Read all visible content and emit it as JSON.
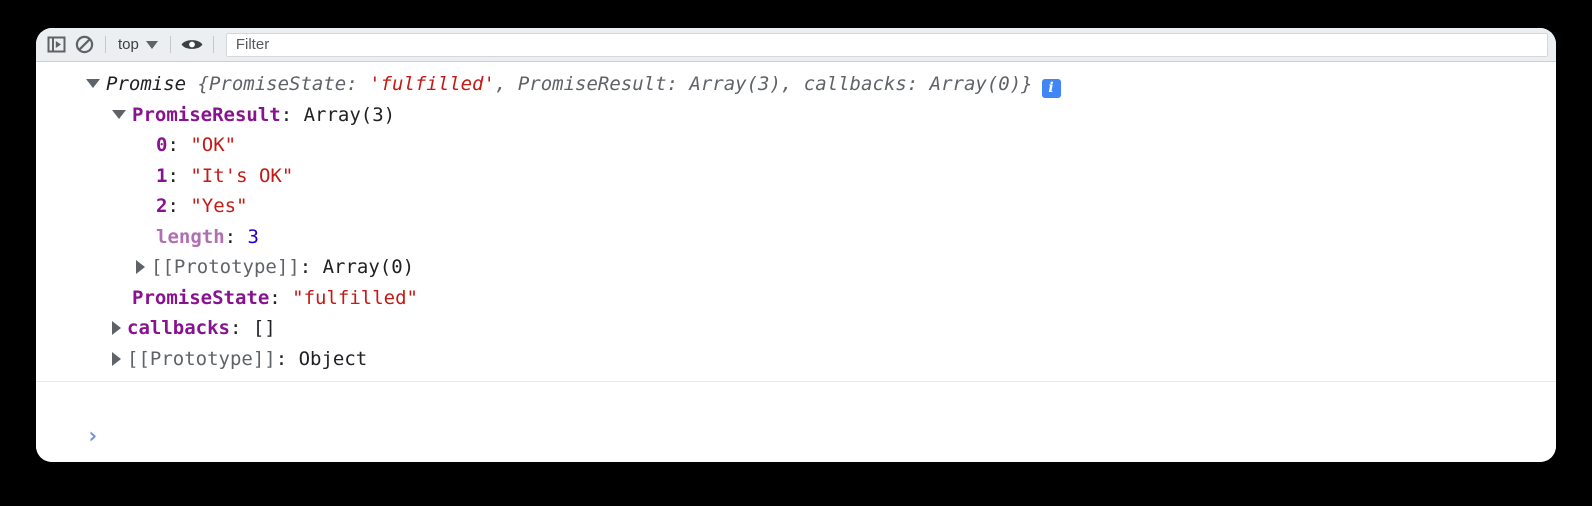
{
  "toolbar": {
    "sidebar_toggle_icon": "sidebar-panel-icon",
    "clear_console_icon": "no-entry-clear-icon",
    "context_label": "top",
    "context_caret_icon": "chevron-down-icon",
    "eye_icon": "eye-live-expression-icon",
    "filter_placeholder": "Filter"
  },
  "console": {
    "lines": [
      {
        "id": "promise-root",
        "indent": 0,
        "twisty": "open",
        "segments": [
          {
            "text": "Promise ",
            "style": "obj-name"
          },
          {
            "text": "{PromiseState: ",
            "style": "preview"
          },
          {
            "text": "'fulfilled'",
            "style": "str-italic"
          },
          {
            "text": ", PromiseResult: Array(3), callbacks: Array(0)}",
            "style": "preview"
          }
        ],
        "badge": "i"
      },
      {
        "id": "promise-result",
        "indent": 1,
        "twisty": "open",
        "segments": [
          {
            "text": "PromiseResult",
            "style": "prop"
          },
          {
            "text": ": ",
            "style": "punct"
          },
          {
            "text": "Array(3)",
            "style": "plain"
          }
        ]
      },
      {
        "id": "array-index-0",
        "indent": 2,
        "twisty": "none",
        "segments": [
          {
            "text": "0",
            "style": "prop"
          },
          {
            "text": ": ",
            "style": "punct"
          },
          {
            "text": "\"OK\"",
            "style": "string"
          }
        ]
      },
      {
        "id": "array-index-1",
        "indent": 2,
        "twisty": "none",
        "segments": [
          {
            "text": "1",
            "style": "prop"
          },
          {
            "text": ": ",
            "style": "punct"
          },
          {
            "text": "\"It's OK\"",
            "style": "string"
          }
        ]
      },
      {
        "id": "array-index-2",
        "indent": 2,
        "twisty": "none",
        "segments": [
          {
            "text": "2",
            "style": "prop"
          },
          {
            "text": ": ",
            "style": "punct"
          },
          {
            "text": "\"Yes\"",
            "style": "string"
          }
        ]
      },
      {
        "id": "array-length",
        "indent": 2,
        "twisty": "none",
        "segments": [
          {
            "text": "length",
            "style": "prop-dim"
          },
          {
            "text": ": ",
            "style": "punct"
          },
          {
            "text": "3",
            "style": "number"
          }
        ]
      },
      {
        "id": "array-prototype",
        "indent": 2,
        "twisty": "closed",
        "segments": [
          {
            "text": "[[Prototype]]",
            "style": "internal"
          },
          {
            "text": ": ",
            "style": "punct"
          },
          {
            "text": "Array(0)",
            "style": "plain"
          }
        ]
      },
      {
        "id": "promise-state",
        "indent": 1,
        "twisty": "none",
        "segments": [
          {
            "text": "PromiseState",
            "style": "prop"
          },
          {
            "text": ": ",
            "style": "punct"
          },
          {
            "text": "\"fulfilled\"",
            "style": "string"
          }
        ]
      },
      {
        "id": "callbacks",
        "indent": 1,
        "twisty": "closed",
        "segments": [
          {
            "text": "callbacks",
            "style": "prop"
          },
          {
            "text": ": ",
            "style": "punct"
          },
          {
            "text": "[]",
            "style": "plain"
          }
        ]
      },
      {
        "id": "object-prototype",
        "indent": 1,
        "twisty": "closed",
        "segments": [
          {
            "text": "[[Prototype]]",
            "style": "internal"
          },
          {
            "text": ": ",
            "style": "punct"
          },
          {
            "text": "Object",
            "style": "plain"
          }
        ]
      }
    ]
  },
  "prompt": {
    "chevron": "›"
  },
  "colors": {
    "toolbar_bg": "#ebeff1",
    "property_purple": "#881391",
    "property_dim_purple": "#b06fb0",
    "string_red": "#c41a16",
    "number_blue": "#1c00cf",
    "internal_gray": "#5f6368",
    "info_badge_blue": "#4285f4",
    "prompt_blue": "#6e8fdd"
  }
}
